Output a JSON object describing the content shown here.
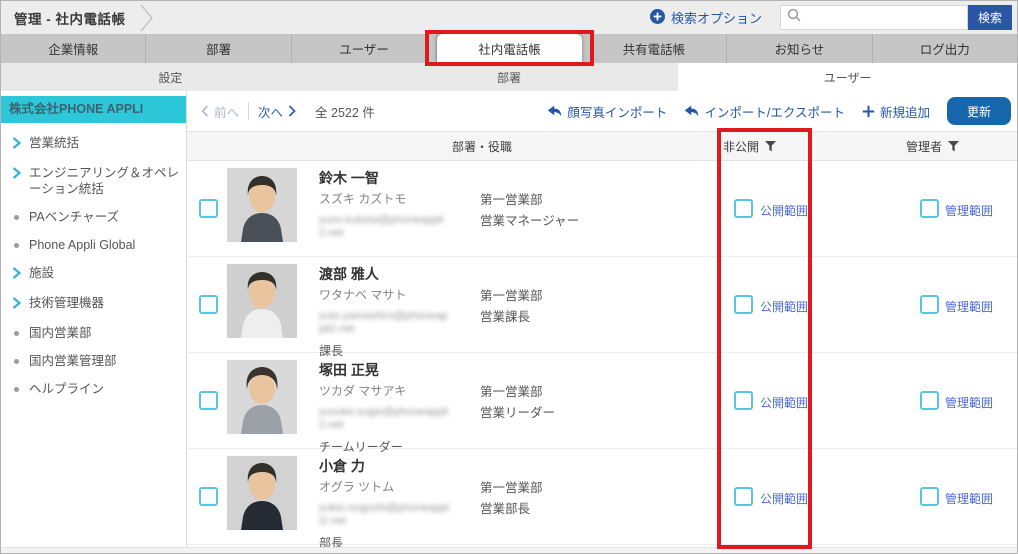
{
  "colors": {
    "accent_blue": "#2457a8",
    "search_button_blue": "#2a56a5",
    "update_button_blue": "#1767ad",
    "sidebar_cyan": "#2cc8d9",
    "checkbox_cyan": "#58c6e3",
    "range_link_blue": "#4a6bd4",
    "annotation_red": "#e01a1a",
    "tabbar_gray": "#c6c6c6"
  },
  "topbar": {
    "title": "管理 - 社内電話帳",
    "search_options": "検索オプション",
    "search_value": "",
    "search_button": "検索"
  },
  "tabs": [
    "企業情報",
    "部署",
    "ユーザー",
    "社内電話帳",
    "共有電話帳",
    "お知らせ",
    "ログ出力"
  ],
  "subtabs": [
    "設定",
    "部署",
    "ユーザー"
  ],
  "sidebar": {
    "company": "株式会社PHONE APPLI",
    "items": [
      {
        "label": "営業統括",
        "icon": "chevron"
      },
      {
        "label": "エンジニアリング＆オペレーション統括",
        "icon": "chevron"
      },
      {
        "label": "PAベンチャーズ",
        "icon": "bullet"
      },
      {
        "label": "Phone Appli Global",
        "icon": "bullet"
      },
      {
        "label": "施設",
        "icon": "chevron"
      },
      {
        "label": "技術管理機器",
        "icon": "chevron"
      },
      {
        "label": "国内営業部",
        "icon": "bullet"
      },
      {
        "label": "国内営業管理部",
        "icon": "bullet"
      },
      {
        "label": "ヘルプライン",
        "icon": "bullet"
      }
    ]
  },
  "toolbar": {
    "prev": "前へ",
    "next": "次へ",
    "total": "全 2522 件",
    "photo_import": "顔写真インポート",
    "import_export": "インポート/エクスポート",
    "add_new": "新規追加",
    "update": "更新"
  },
  "table": {
    "headers": {
      "dept": "部署・役職",
      "private": "非公開",
      "admin": "管理者"
    },
    "visibility_link": "公開範囲",
    "admin_link": "管理範囲",
    "rows": [
      {
        "name": "鈴木 一智",
        "kana": "スズキ カズトモ",
        "email": "yuzo.kubota@phoneappli2.net",
        "title": "",
        "dept": "第一営業部",
        "role": "営業マネージャー"
      },
      {
        "name": "渡部 雅人",
        "kana": "ワタナベ マサト",
        "email": "yuto.yamashiro@phoneappli2.net",
        "title": "課長",
        "dept": "第一営業部",
        "role": "営業課長"
      },
      {
        "name": "塚田 正晃",
        "kana": "ツカダ マサアキ",
        "email": "yusuke.sugio@phoneappli2.net",
        "title": "チームリーダー",
        "dept": "第一営業部",
        "role": "営業リーダー"
      },
      {
        "name": "小倉 力",
        "kana": "オグラ ツトム",
        "email": "yukio.nogoshi@phoneappli2.net",
        "title": "部長",
        "dept": "第一営業部",
        "role": "営業部長"
      }
    ]
  }
}
